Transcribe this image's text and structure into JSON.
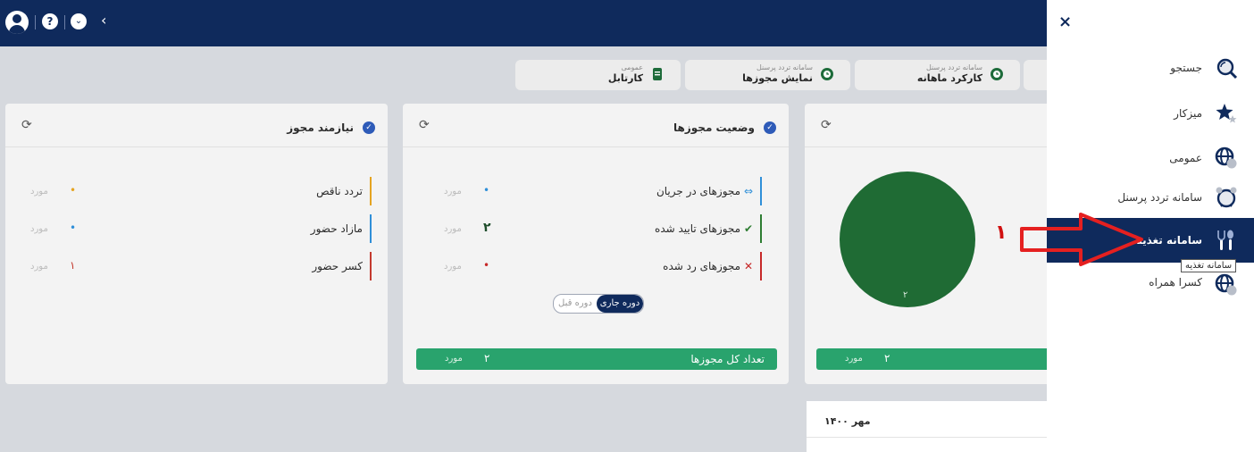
{
  "topbar": {
    "help_label": "?",
    "dropdown_label": "⌄",
    "back_label": "‹"
  },
  "sidebar": {
    "close_label": "×",
    "items": [
      {
        "label": "جستجو",
        "icon": "search-icon"
      },
      {
        "label": "میزکار",
        "icon": "star-icon"
      },
      {
        "label": "عمومی",
        "icon": "globe-icon"
      },
      {
        "label": "سامانه تردد پرسنل",
        "icon": "alarm-clock-icon"
      },
      {
        "label": "سامانه تغذیه",
        "icon": "cutlery-icon",
        "active": true
      },
      {
        "label": "کسرا همراه",
        "icon": "globe-icon"
      }
    ],
    "tooltip": "سامانه تغذیه"
  },
  "tabs": [
    {
      "category": "سامانه تردد پرسنل",
      "title": "کارکرد ماهانه"
    },
    {
      "category": "سامانه تردد پرسنل",
      "title": "نمایش مجوزها"
    },
    {
      "category": "عمومی",
      "title": "کارتابل"
    }
  ],
  "cards": {
    "needs_permit": {
      "title": "نیازمند مجوز",
      "rows": [
        {
          "label": "تردد ناقص",
          "value": "•",
          "unit": "مورد",
          "color": "#e5a421"
        },
        {
          "label": "مازاد حضور",
          "value": "•",
          "unit": "مورد",
          "color": "#2f8fd8"
        },
        {
          "label": "کسر حضور",
          "value": "۱",
          "unit": "مورد",
          "color": "#c43a2e"
        }
      ]
    },
    "permit_status": {
      "title": "وضعیت مجوزها",
      "rows": [
        {
          "label": "مجوزهای در جریان",
          "value": "•",
          "unit": "مورد",
          "color": "#2f8fd8",
          "icon": "⇔"
        },
        {
          "label": "مجوزهای تایید شده",
          "value": "۲",
          "unit": "مورد",
          "color": "#2e7d32",
          "icon": "✔"
        },
        {
          "label": "مجوزهای رد شده",
          "value": "•",
          "unit": "مورد",
          "color": "#c62828",
          "icon": "✕"
        }
      ],
      "toggle": {
        "current": "دوره جاری",
        "previous": "دوره قبل"
      },
      "total": {
        "label": "تعداد کل مجوزها",
        "value": "۲",
        "unit": "مورد"
      }
    },
    "pie": {
      "slice_label": "۲",
      "total_value": "۲",
      "total_unit": "مورد",
      "color": "#1f6b34"
    }
  },
  "annotation": {
    "number": "۱"
  },
  "date_label": "مهر ۱۴۰۰"
}
